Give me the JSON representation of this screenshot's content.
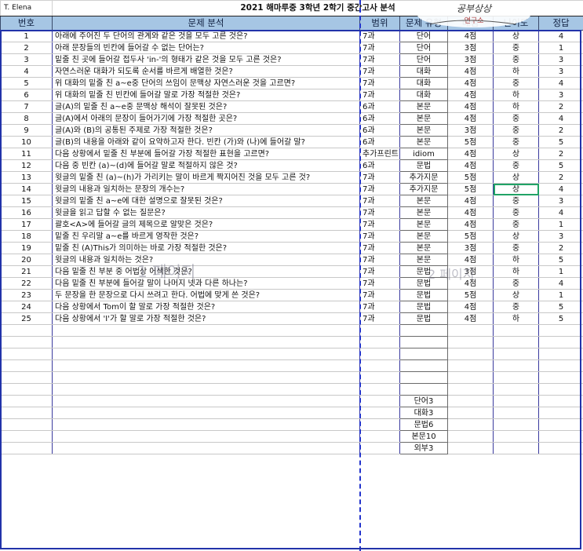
{
  "sheet": {
    "author": "T. Elena",
    "title": "2021 해마루중 3학년 2학기 중간고사 분석",
    "headers": {
      "no": "번호",
      "question": "문제 분석",
      "range": "범위",
      "type": "문제 유형",
      "points": "배점",
      "difficulty": "난이도",
      "answer": "정답"
    },
    "rows": [
      {
        "no": "1",
        "question": "아래에 주어진 두 단어의 관계와 같은 것을 모두 고른 것은?",
        "range": "7과",
        "type": "단어",
        "points": "4점",
        "difficulty": "상",
        "answer": "4"
      },
      {
        "no": "2",
        "question": "아래 문장들의 빈칸에 들어갈 수 없는 단어는?",
        "range": "7과",
        "type": "단어",
        "points": "3점",
        "difficulty": "중",
        "answer": "1"
      },
      {
        "no": "3",
        "question": "밑줄 친 곳에 들어갈 접두사 'in-'의 형태가 같은 것을 모두 고른 것은?",
        "range": "7과",
        "type": "단어",
        "points": "3점",
        "difficulty": "중",
        "answer": "3"
      },
      {
        "no": "4",
        "question": "자연스러운 대화가 되도록 순서를 바르게 배열한 것은?",
        "range": "7과",
        "type": "대화",
        "points": "4점",
        "difficulty": "하",
        "answer": "3"
      },
      {
        "no": "5",
        "question": "위 대화의 밑줄 친 a~e중 단어의 쓰임이 문맥상 자연스러운 것을 고르면?",
        "range": "7과",
        "type": "대화",
        "points": "4점",
        "difficulty": "중",
        "answer": "4"
      },
      {
        "no": "6",
        "question": "위 대화의 밑줄 친 빈칸에 들어갈 말로 가장 적절한 것은?",
        "range": "7과",
        "type": "대화",
        "points": "4점",
        "difficulty": "하",
        "answer": "3"
      },
      {
        "no": "7",
        "question": "글(A)의 밑줄 친 a~e중 문맥상 해석이 잘못된 것은?",
        "range": "6과",
        "type": "본문",
        "points": "4점",
        "difficulty": "하",
        "answer": "2"
      },
      {
        "no": "8",
        "question": "글(A)에서 아래의 문장이 들어가기에 가장 적절한 곳은?",
        "range": "6과",
        "type": "본문",
        "points": "4점",
        "difficulty": "중",
        "answer": "4"
      },
      {
        "no": "9",
        "question": "글(A)와 (B)의 공통된 주제로 가장 적절한 것은?",
        "range": "6과",
        "type": "본문",
        "points": "3점",
        "difficulty": "중",
        "answer": "2"
      },
      {
        "no": "10",
        "question": "글(B)의 내용을 아래와 같이 요약하고자 한다. 빈칸 (가)와 (나)에 들어갈 말?",
        "range": "6과",
        "type": "본문",
        "points": "5점",
        "difficulty": "중",
        "answer": "5"
      },
      {
        "no": "11",
        "question": "다음 상황에서 밑줄 친 부분에 들어갈 가장 적절한 표현을 고르면?",
        "range": "추가프린트",
        "type": "idiom",
        "points": "4점",
        "difficulty": "상",
        "answer": "2"
      },
      {
        "no": "12",
        "question": "다음 중 빈칸 (a)~(d)에 들어갈 말로 적절하지 않은 것?",
        "range": "6과",
        "type": "문법",
        "points": "4점",
        "difficulty": "중",
        "answer": "5"
      },
      {
        "no": "13",
        "question": "윗글의 밑줄 친 (a)~(h)가 가리키는 말이 바르게 짝지어진 것을 모두 고른 것?",
        "range": "7과",
        "type": "추가지문",
        "points": "5점",
        "difficulty": "상",
        "answer": "2"
      },
      {
        "no": "14",
        "question": "윗글의 내용과 일치하는 문장의 개수는?",
        "range": "7과",
        "type": "추가지문",
        "points": "5점",
        "difficulty": "상",
        "answer": "4"
      },
      {
        "no": "15",
        "question": "윗글의 밑줄 친 a~e에 대한 설명으로 잘못된 것은?",
        "range": "7과",
        "type": "본문",
        "points": "4점",
        "difficulty": "중",
        "answer": "3"
      },
      {
        "no": "16",
        "question": "윗글을 읽고 답할 수 없는 질문은?",
        "range": "7과",
        "type": "본문",
        "points": "4점",
        "difficulty": "중",
        "answer": "4"
      },
      {
        "no": "17",
        "question": "괄호<A>에 들어갈 글의 제목으로 알맞은 것은?",
        "range": "7과",
        "type": "본문",
        "points": "4점",
        "difficulty": "중",
        "answer": "1"
      },
      {
        "no": "18",
        "question": "밑줄 친 우리말 a~e를 바르게 영작한 것은?",
        "range": "7과",
        "type": "본문",
        "points": "5점",
        "difficulty": "상",
        "answer": "3"
      },
      {
        "no": "19",
        "question": "밑줄 친 (A)This가 의미하는 바로 가장 적절한 것은?",
        "range": "7과",
        "type": "본문",
        "points": "3점",
        "difficulty": "중",
        "answer": "2"
      },
      {
        "no": "20",
        "question": "윗글의 내용과 일치하는 것은?",
        "range": "7과",
        "type": "본문",
        "points": "4점",
        "difficulty": "하",
        "answer": "5"
      },
      {
        "no": "21",
        "question": "다음 밑줄 친 부분 중 어법상 어색한 것은?",
        "range": "7과",
        "type": "문법",
        "points": "3점",
        "difficulty": "하",
        "answer": "1"
      },
      {
        "no": "22",
        "question": "다음 밑줄 친 부분에 들어갈 말이 나머지 넷과 다른 하나는?",
        "range": "7과",
        "type": "문법",
        "points": "4점",
        "difficulty": "중",
        "answer": "4"
      },
      {
        "no": "23",
        "question": "두 문장을 한 문장으로 다시 쓰려고 한다. 어법에 맞게 쓴 것은?",
        "range": "7과",
        "type": "문법",
        "points": "5점",
        "difficulty": "상",
        "answer": "1"
      },
      {
        "no": "24",
        "question": "다음 상황에서 Tom이 할 말로 가장 적절한 것은?",
        "range": "7과",
        "type": "문법",
        "points": "4점",
        "difficulty": "중",
        "answer": "5"
      },
      {
        "no": "25",
        "question": "다음 상황에서 'I'가 할 말로 가장 적절한 것은?",
        "range": "7과",
        "type": "문법",
        "points": "4점",
        "difficulty": "하",
        "answer": "5"
      }
    ],
    "summary": [
      "단어3",
      "대화3",
      "문법6",
      "본문10",
      "외부3"
    ],
    "watermarks": {
      "page1": "1 페이지",
      "page2": "2 페이지"
    },
    "stamp_text": "공부상상연구소"
  },
  "colors": {
    "header_bg": "#a6c6e4",
    "frame_border": "#2233aa",
    "selection": "#21a366"
  }
}
